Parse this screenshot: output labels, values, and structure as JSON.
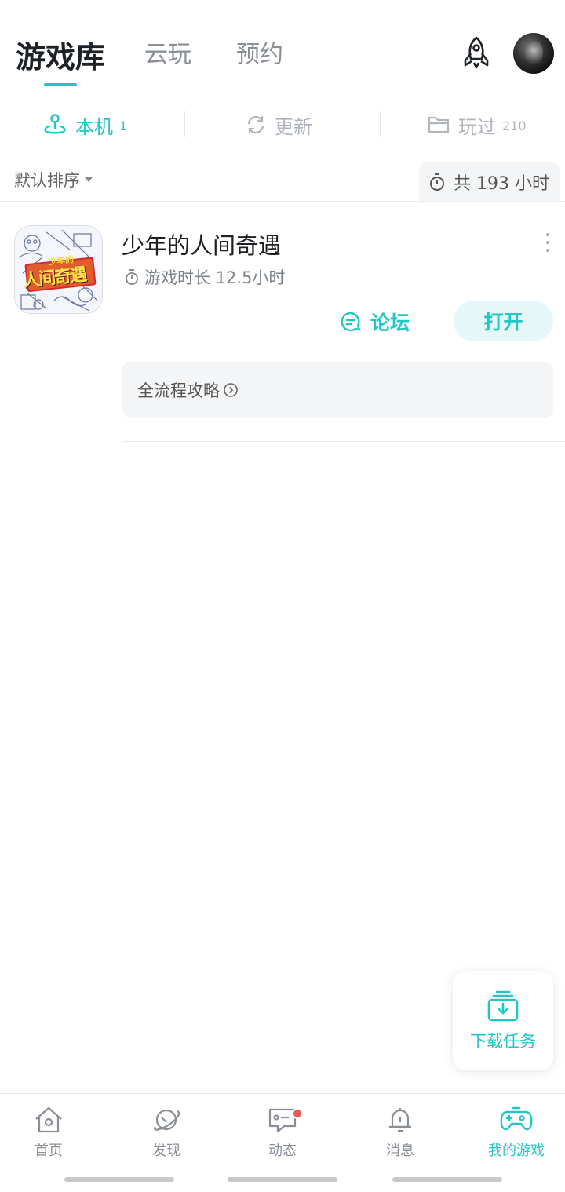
{
  "header": {
    "tabs": [
      {
        "label": "游戏库",
        "active": true
      },
      {
        "label": "云玩",
        "active": false
      },
      {
        "label": "预约",
        "active": false
      }
    ]
  },
  "subtabs": [
    {
      "label": "本机",
      "count": "1",
      "icon": "local-device-icon",
      "active": true
    },
    {
      "label": "更新",
      "count": "",
      "icon": "refresh-icon",
      "active": false
    },
    {
      "label": "玩过",
      "count": "210",
      "icon": "folder-icon",
      "active": false
    }
  ],
  "sort": {
    "label": "默认排序"
  },
  "total_time": {
    "label": "共 193 小时"
  },
  "game": {
    "title": "少年的人间奇遇",
    "play_time": "游戏时长 12.5小时",
    "icon_text_top": "少年的",
    "icon_text_main": "人间奇遇",
    "forum_label": "论坛",
    "open_label": "打开",
    "guide_label": "全流程攻略"
  },
  "download_task": {
    "label": "下载任务"
  },
  "bottom_nav": [
    {
      "label": "首页",
      "icon": "home-icon",
      "active": false
    },
    {
      "label": "发现",
      "icon": "planet-icon",
      "active": false
    },
    {
      "label": "动态",
      "icon": "chat-icon",
      "active": false,
      "badge": true
    },
    {
      "label": "消息",
      "icon": "bell-icon",
      "active": false
    },
    {
      "label": "我的游戏",
      "icon": "gamepad-icon",
      "active": true
    }
  ],
  "colors": {
    "accent": "#23c6c8",
    "badge": "#f0555a"
  }
}
